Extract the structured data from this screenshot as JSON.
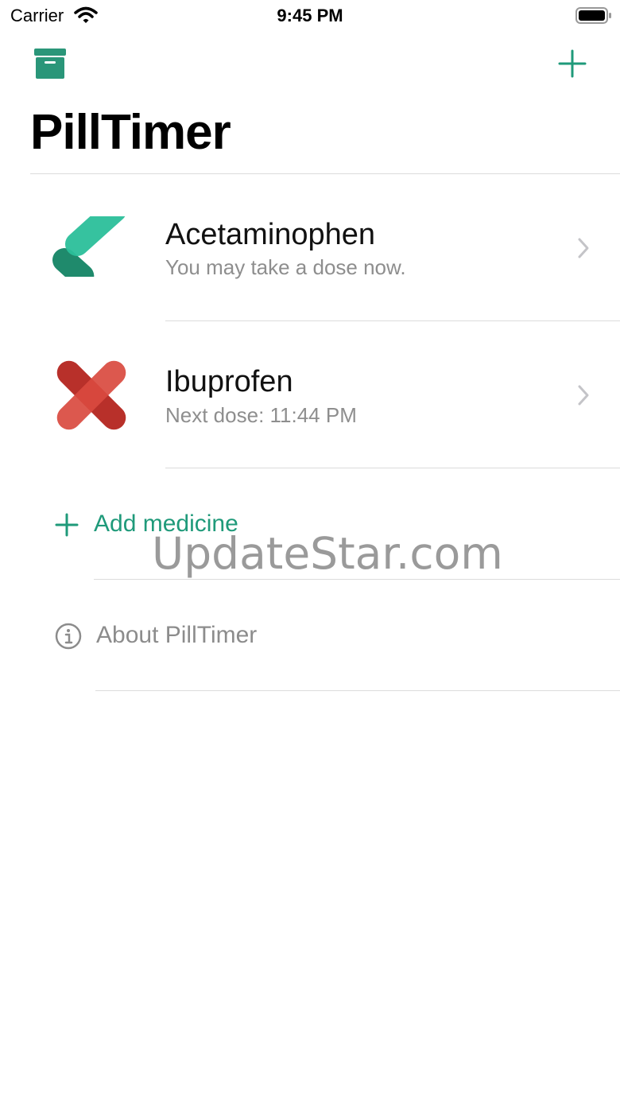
{
  "status_bar": {
    "carrier": "Carrier",
    "time": "9:45 PM",
    "icons": [
      "wifi-icon",
      "battery-icon"
    ]
  },
  "nav": {
    "left_icon": "archive-icon",
    "right_icon": "plus-icon",
    "title": "PillTimer"
  },
  "colors": {
    "accent": "#1f9a7a",
    "ok_green": "#2bbf9a",
    "wait_red": "#d94a3f",
    "secondary_text": "#8e8e8e",
    "separator": "#dcdcdc"
  },
  "medicines": [
    {
      "name": "Acetaminophen",
      "status": "You may take a dose now.",
      "icon": "checkmark-icon"
    },
    {
      "name": "Ibuprofen",
      "status": "Next dose: 11:44 PM",
      "icon": "cross-icon"
    }
  ],
  "actions": {
    "add_medicine": "Add medicine",
    "about": "About PillTimer"
  },
  "watermark": "UpdateStar.com"
}
